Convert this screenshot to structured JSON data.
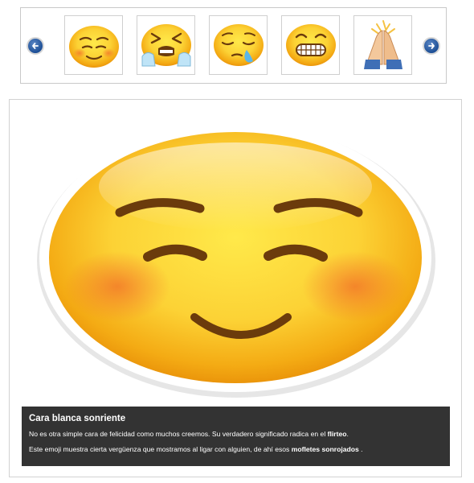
{
  "carousel": {
    "prev_icon": "arrow-left-icon",
    "next_icon": "arrow-right-icon",
    "thumbnails": [
      {
        "emoji": "smiling-face-with-blush"
      },
      {
        "emoji": "loudly-crying-face"
      },
      {
        "emoji": "sleepy-face"
      },
      {
        "emoji": "grimacing-face"
      },
      {
        "emoji": "folded-hands"
      }
    ]
  },
  "featured": {
    "emoji": "smiling-face-with-blush",
    "title": "Cara blanca sonriente",
    "line1_text": "No es otra simple cara de felicidad como muchos creemos. Su verdadero significado radica en el ",
    "line1_bold": "flirteo",
    "line1_end": ".",
    "line2_text": "Este emoji muestra cierta vergüenza que mostramos al ligar con alguien, de ahí esos ",
    "line2_bold": "mofletes sonrojados",
    "line2_end": " ."
  },
  "colors": {
    "emoji_yellow": "#fbd43a",
    "emoji_orange": "#f2a20c",
    "blush": "#f08a3a",
    "feature": "#6b3b0c",
    "caption_bg": "#333333",
    "nav_blue": "#1d4f96"
  }
}
